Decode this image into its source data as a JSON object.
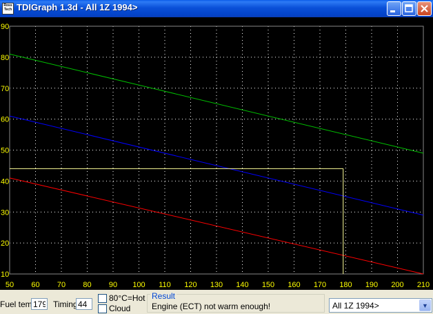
{
  "window": {
    "title": "TDIGraph 1.3d - All 1Z 1994>",
    "icon_text": "Ross Tech",
    "minimize_icon": "minimize-icon",
    "maximize_icon": "maximize-icon",
    "close_icon": "close-icon"
  },
  "toolbar": {
    "fuel_temp_label": "Fuel temp",
    "fuel_temp_value": "179",
    "timing_label": "Timing",
    "timing_value": "44",
    "hot_checkbox_label": "80°C=Hot",
    "cloud_checkbox_label": "Cloud",
    "hot_checked": false,
    "cloud_checked": false,
    "result_title": "Result",
    "result_message": "Engine (ECT) not warm enough!",
    "engine_select_value": "All 1Z 1994>"
  },
  "chart_data": {
    "type": "line",
    "x_ticks": [
      50,
      60,
      70,
      80,
      90,
      100,
      110,
      120,
      130,
      140,
      150,
      160,
      170,
      180,
      190,
      200,
      210
    ],
    "y_ticks": [
      10,
      20,
      30,
      40,
      50,
      60,
      70,
      80,
      90
    ],
    "xlim": [
      50,
      210
    ],
    "ylim": [
      10,
      90
    ],
    "grid": true,
    "colors": {
      "background": "#000000",
      "grid": "#ffffff",
      "axis_text": "#ffff00",
      "marker": "#ffff99"
    },
    "series": [
      {
        "color": "#00c000",
        "x": [
          50,
          210
        ],
        "y": [
          81,
          49
        ]
      },
      {
        "color": "#0000ff",
        "x": [
          50,
          210
        ],
        "y": [
          61,
          29
        ]
      },
      {
        "color": "#ff0000",
        "x": [
          50,
          210
        ],
        "y": [
          41,
          10
        ]
      }
    ],
    "marker": {
      "x": 179,
      "y": 44
    }
  }
}
